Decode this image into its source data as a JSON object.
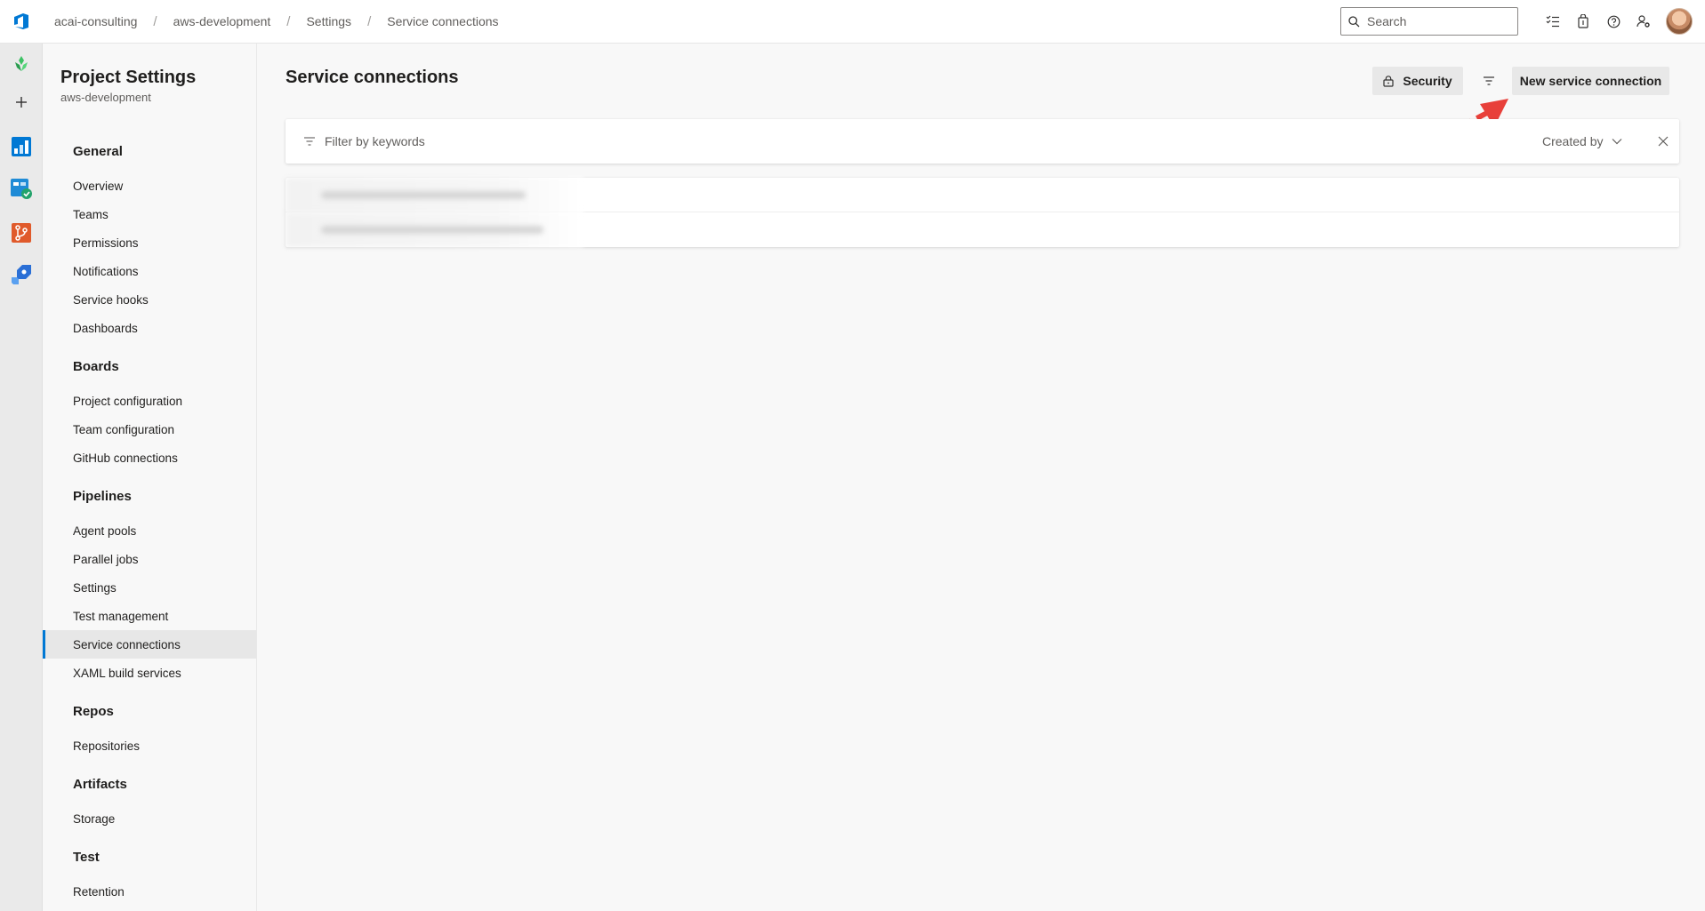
{
  "breadcrumb": {
    "org": "acai-consulting",
    "project": "aws-development",
    "settings": "Settings",
    "current": "Service connections"
  },
  "search": {
    "placeholder": "Search"
  },
  "nav": {
    "title": "Project Settings",
    "subtitle": "aws-development",
    "groups": {
      "general": {
        "label": "General",
        "items": [
          "Overview",
          "Teams",
          "Permissions",
          "Notifications",
          "Service hooks",
          "Dashboards"
        ]
      },
      "boards": {
        "label": "Boards",
        "items": [
          "Project configuration",
          "Team configuration",
          "GitHub connections"
        ]
      },
      "pipelines": {
        "label": "Pipelines",
        "items": [
          "Agent pools",
          "Parallel jobs",
          "Settings",
          "Test management",
          "Service connections",
          "XAML build services"
        ]
      },
      "repos": {
        "label": "Repos",
        "items": [
          "Repositories"
        ]
      },
      "artifacts": {
        "label": "Artifacts",
        "items": [
          "Storage"
        ]
      },
      "test": {
        "label": "Test",
        "items": [
          "Retention"
        ]
      }
    },
    "selected": "Service connections"
  },
  "main": {
    "title": "Service connections",
    "security_label": "Security",
    "new_label": "New service connection",
    "filter_placeholder": "Filter by keywords",
    "created_by_label": "Created by"
  },
  "colors": {
    "accent": "#0078d4",
    "arrow": "#e8403a",
    "repos": "#e05a2b",
    "pipelines": "#2a6fd6",
    "test_plans": "#23a36b"
  }
}
